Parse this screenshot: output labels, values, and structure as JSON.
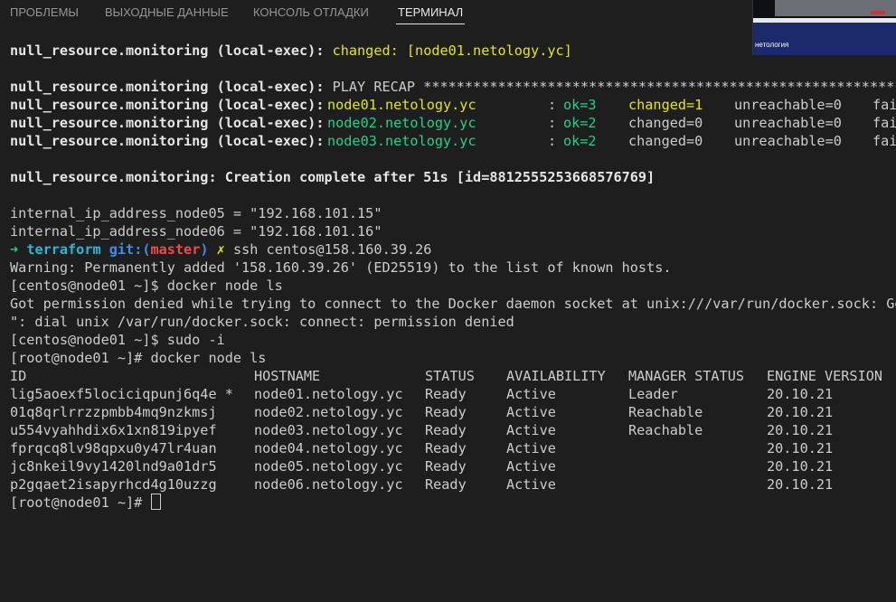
{
  "tabs": [
    {
      "label": "ПРОБЛЕМЫ"
    },
    {
      "label": "ВЫХОДНЫЕ ДАННЫЕ"
    },
    {
      "label": "КОНСОЛЬ ОТЛАДКИ"
    },
    {
      "label": "ТЕРМИНАЛ"
    }
  ],
  "overlay": {
    "logo_text": "нетология"
  },
  "colors": {
    "background": "#1e1e1e",
    "text": "#cccccc",
    "yellow": "#e5e510",
    "green": "#23d18b",
    "cyan": "#29b8db",
    "blue": "#3b8eea",
    "red": "#f14c4c"
  },
  "terminal": {
    "changed_prefix": "null_resource.monitoring (local-exec): ",
    "changed_text": "changed: [node01.netology.yc]",
    "recap_prefix": "null_resource.monitoring (local-exec): ",
    "recap_text": "PLAY RECAP *************************************************************",
    "recap_rows": [
      {
        "prefix": "null_resource.monitoring (local-exec): ",
        "host": "node01.netology.yc",
        "sep": ": ",
        "ok": "ok=3",
        "changed": "changed=1",
        "unreachable": "unreachable=0",
        "failed": "fai"
      },
      {
        "prefix": "null_resource.monitoring (local-exec): ",
        "host": "node02.netology.yc",
        "sep": ": ",
        "ok": "ok=2",
        "changed": "changed=0",
        "unreachable": "unreachable=0",
        "failed": "fai"
      },
      {
        "prefix": "null_resource.monitoring (local-exec): ",
        "host": "node03.netology.yc",
        "sep": ": ",
        "ok": "ok=2",
        "changed": "changed=0",
        "unreachable": "unreachable=0",
        "failed": "fai"
      }
    ],
    "creation_complete": "null_resource.monitoring: Creation complete after 51s [id=8812555253668576769]",
    "outputs": [
      "internal_ip_address_node05 = \"192.168.101.15\"",
      "internal_ip_address_node06 = \"192.168.101.16\""
    ],
    "prompt": {
      "arrow": "➜",
      "dir": "terraform",
      "git": "git:(",
      "branch": "master",
      "git_close": ")",
      "dirty": "✗",
      "command": "ssh centos@158.160.39.26"
    },
    "warning": "Warning: Permanently added '158.160.39.26' (ED25519) to the list of known hosts.",
    "centos_prompt1": "[centos@node01 ~]$ docker node ls",
    "perm_denied1": "Got permission denied while trying to connect to the Docker daemon socket at unix:///var/run/docker.sock: Get",
    "perm_denied2": "\": dial unix /var/run/docker.sock: connect: permission denied",
    "centos_prompt2": "[centos@node01 ~]$ sudo -i",
    "root_prompt1": "[root@node01 ~]# docker node ls",
    "table_headers": {
      "id": "ID",
      "hostname": "HOSTNAME",
      "status": "STATUS",
      "availability": "AVAILABILITY",
      "manager": "MANAGER STATUS",
      "engine": "ENGINE VERSION"
    },
    "nodes": [
      {
        "id": "lig5aoexf5lociciqpunj6q4e *",
        "hostname": "node01.netology.yc",
        "status": "Ready",
        "availability": "Active",
        "manager": "Leader",
        "engine": "20.10.21"
      },
      {
        "id": "01q8qrlrrzzpmbb4mq9nzkmsj",
        "hostname": "node02.netology.yc",
        "status": "Ready",
        "availability": "Active",
        "manager": "Reachable",
        "engine": "20.10.21"
      },
      {
        "id": "u554vyahhdix6x1xn819ipyef",
        "hostname": "node03.netology.yc",
        "status": "Ready",
        "availability": "Active",
        "manager": "Reachable",
        "engine": "20.10.21"
      },
      {
        "id": "fprqcq8lv98qpxu0y47lr4uan",
        "hostname": "node04.netology.yc",
        "status": "Ready",
        "availability": "Active",
        "manager": "",
        "engine": "20.10.21"
      },
      {
        "id": "jc8nkeil9vy1420lnd9a01dr5",
        "hostname": "node05.netology.yc",
        "status": "Ready",
        "availability": "Active",
        "manager": "",
        "engine": "20.10.21"
      },
      {
        "id": "p2gqaet2isapyrhcd4g10uzzg",
        "hostname": "node06.netology.yc",
        "status": "Ready",
        "availability": "Active",
        "manager": "",
        "engine": "20.10.21"
      }
    ],
    "final_prompt": "[root@node01 ~]# "
  }
}
